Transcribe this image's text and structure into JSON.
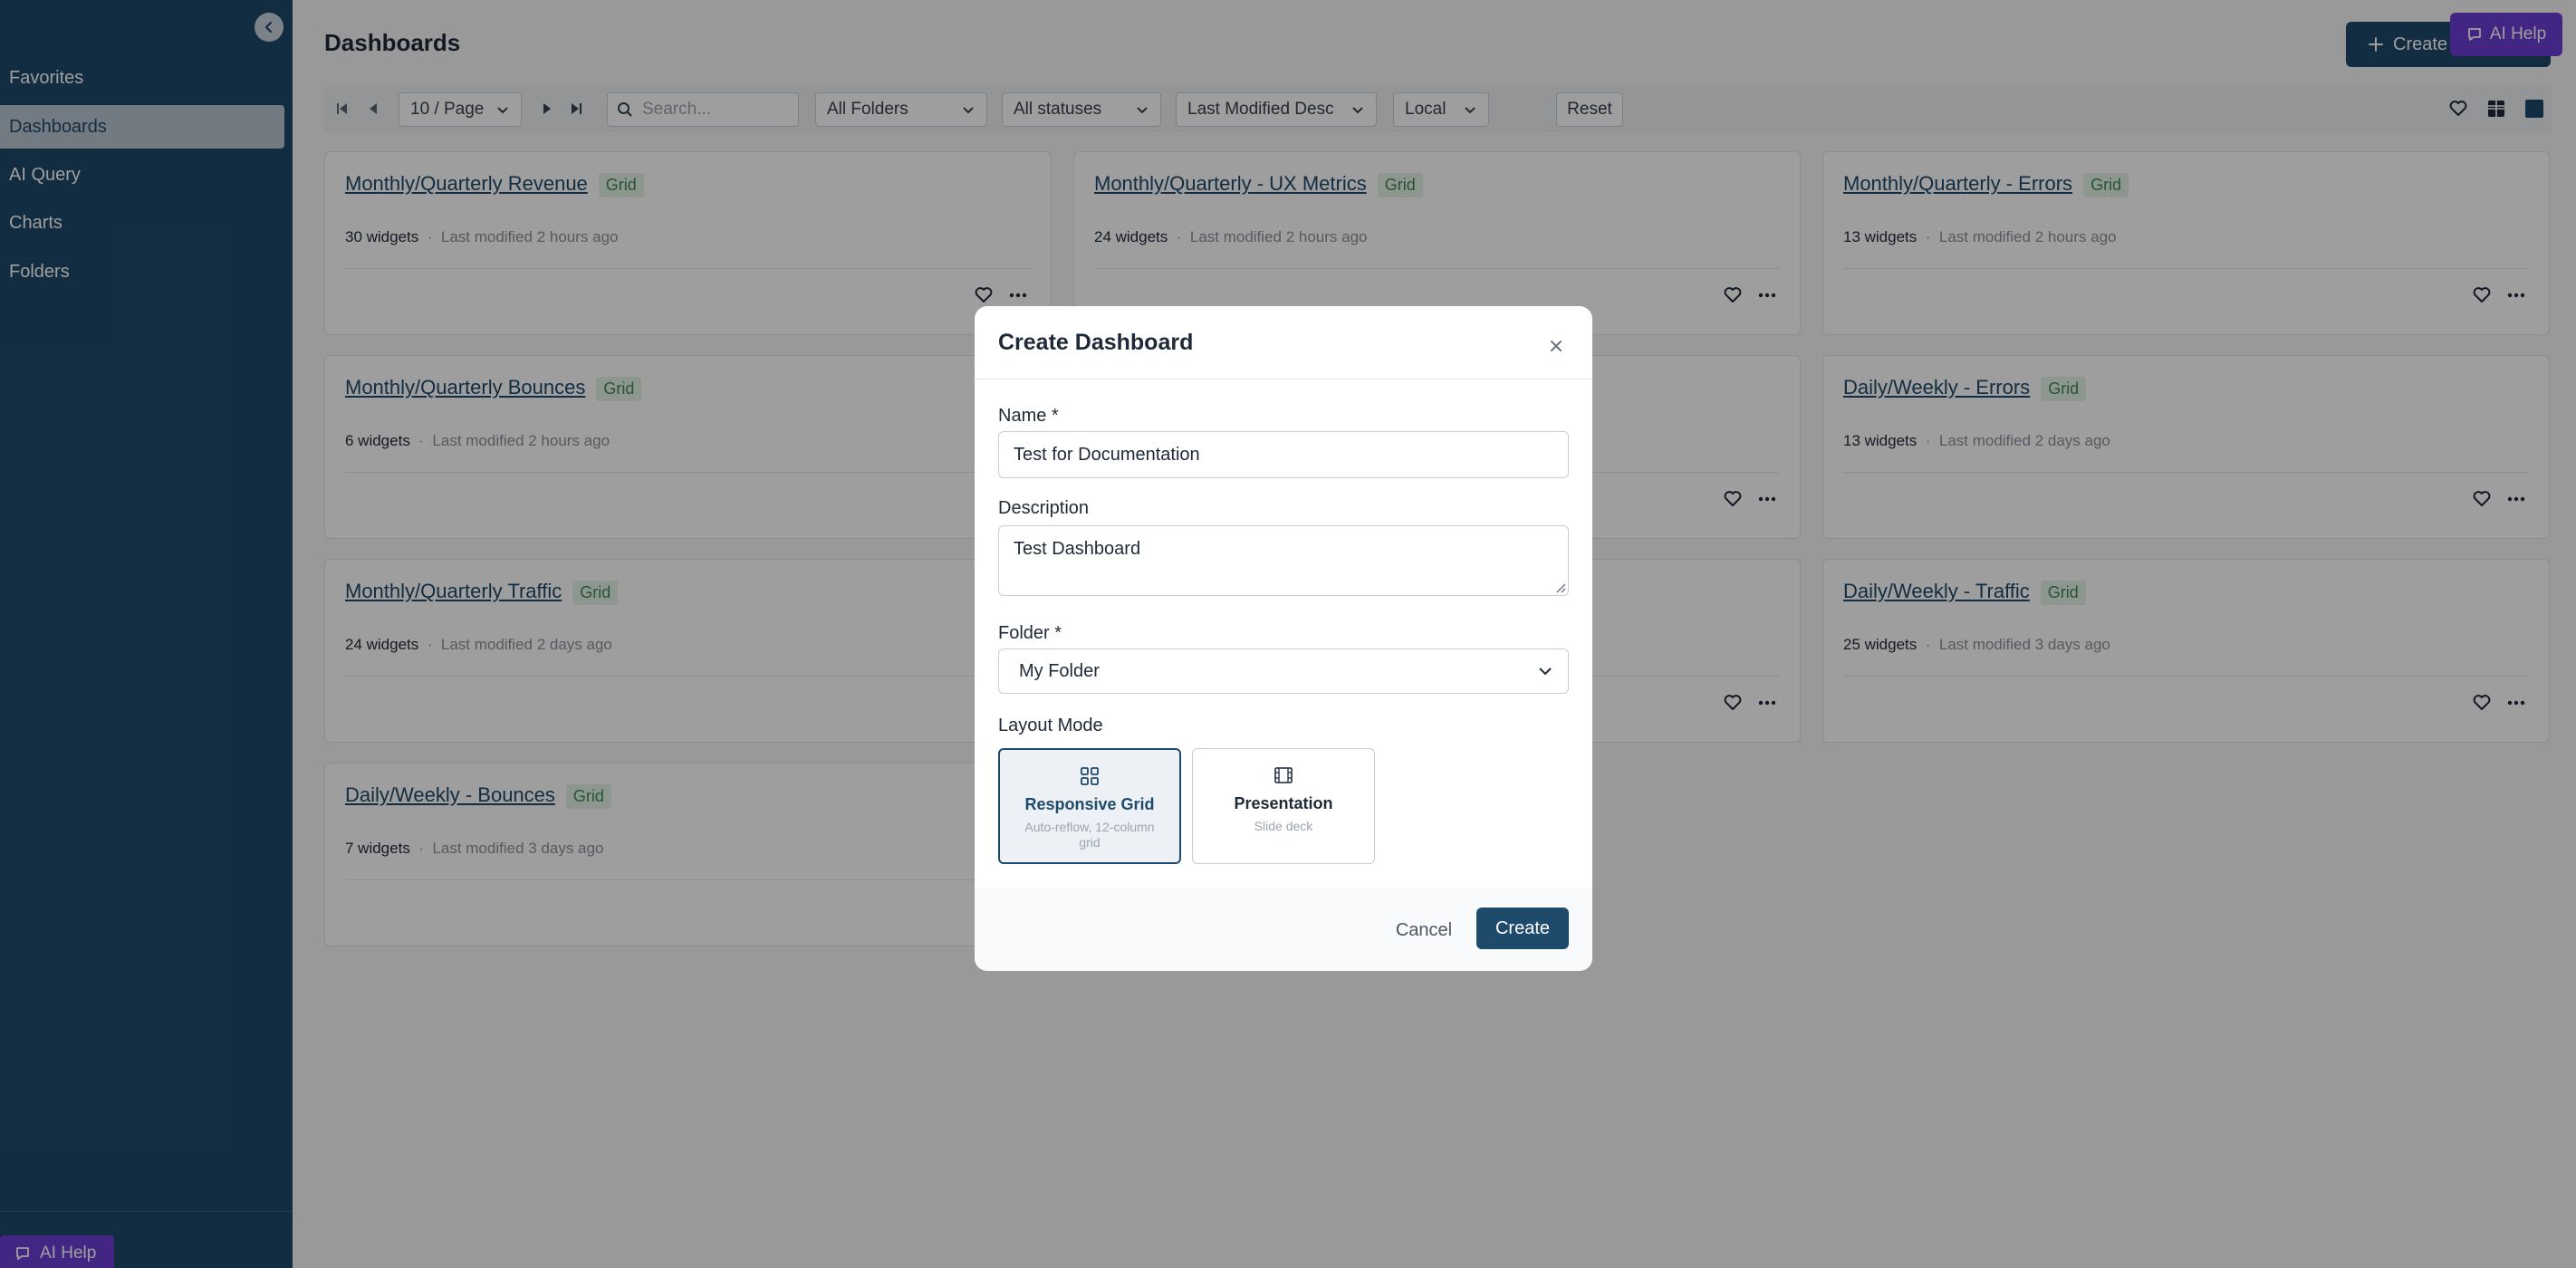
{
  "sidebar": {
    "items": [
      {
        "label": "Favorites"
      },
      {
        "label": "Dashboards"
      },
      {
        "label": "AI Query"
      },
      {
        "label": "Charts"
      },
      {
        "label": "Folders"
      }
    ],
    "active_item": "Dashboards",
    "ai_help_label": "AI Help"
  },
  "header": {
    "title": "Dashboards",
    "create_label": "Create",
    "ai_help_label": "AI Help"
  },
  "toolbar": {
    "page_size": "10 / Page",
    "search_placeholder": "Search...",
    "folder_filter": "All Folders",
    "status_filter": "All statuses",
    "sort": "Last Modified Desc",
    "timezone": "Local",
    "reset_label": "Reset"
  },
  "cards": [
    {
      "title": "Monthly/Quarterly Revenue",
      "badge": "Grid",
      "widgets": "30 widgets",
      "modified": "Last modified 2 hours ago"
    },
    {
      "title": "Monthly/Quarterly - UX Metrics",
      "badge": "Grid",
      "widgets": "24 widgets",
      "modified": "Last modified 2 hours ago"
    },
    {
      "title": "Monthly/Quarterly - Errors",
      "badge": "Grid",
      "widgets": "13 widgets",
      "modified": "Last modified 2 hours ago"
    },
    {
      "title": "Monthly/Quarterly Bounces",
      "badge": "Grid",
      "widgets": "6 widgets",
      "modified": "Last modified 2 hours ago"
    },
    {
      "title": "",
      "badge": "",
      "widgets": "",
      "modified": ""
    },
    {
      "title": "Daily/Weekly - Errors",
      "badge": "Grid",
      "widgets": "13 widgets",
      "modified": "Last modified 2 days ago"
    },
    {
      "title": "Monthly/Quarterly Traffic",
      "badge": "Grid",
      "widgets": "24 widgets",
      "modified": "Last modified 2 days ago"
    },
    {
      "title": "",
      "badge": "",
      "widgets": "",
      "modified": ""
    },
    {
      "title": "Daily/Weekly - Traffic",
      "badge": "Grid",
      "widgets": "25 widgets",
      "modified": "Last modified 3 days ago"
    },
    {
      "title": "Daily/Weekly - Bounces",
      "badge": "Grid",
      "widgets": "7 widgets",
      "modified": "Last modified 3 days ago"
    }
  ],
  "meta_separator": "·",
  "modal": {
    "title": "Create Dashboard",
    "name_label": "Name *",
    "name_value": "Test for Documentation",
    "description_label": "Description",
    "description_value": "Test Dashboard",
    "folder_label": "Folder *",
    "folder_value": "My Folder",
    "layout_label": "Layout Mode",
    "layout_options": [
      {
        "name": "Responsive Grid",
        "desc": "Auto-reflow, 12-column grid",
        "selected": true
      },
      {
        "name": "Presentation",
        "desc": "Slide deck",
        "selected": false
      }
    ],
    "cancel_label": "Cancel",
    "create_label": "Create"
  },
  "colors": {
    "sidebar_bg": "#1e4a6b",
    "primary": "#1e4a6b",
    "ai_help": "#6d3ed6",
    "badge_bg": "#e4f2e7",
    "badge_text": "#3f8a53"
  },
  "icons": [
    "chevron-left-icon",
    "first-page-icon",
    "prev-page-icon",
    "next-page-icon",
    "last-page-icon",
    "search-icon",
    "chevron-down-icon",
    "heart-icon",
    "grid-view-icon",
    "card-view-icon",
    "more-icon",
    "close-icon",
    "grid-layout-icon",
    "presentation-icon",
    "plus-icon",
    "chat-icon"
  ]
}
